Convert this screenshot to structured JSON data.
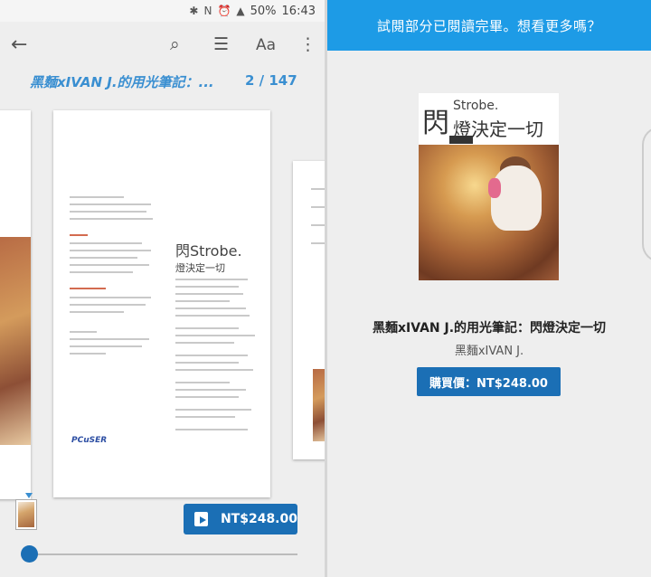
{
  "status_bar": {
    "battery": "50%",
    "time": "16:43",
    "bt_icon": "bluetooth-icon",
    "nfc_icon": "nfc-icon",
    "alarm_icon": "alarm-icon",
    "signal_icon": "signal-icon"
  },
  "reader": {
    "book_title": "黑麵xIVAN J.的用光筆記：...",
    "page_indicator": "2 / 147",
    "aa_label": "Aa",
    "buy_price": "NT$248.00",
    "progress_fraction": 0.03
  },
  "preview_end": {
    "banner": "試閱部分已閱讀完畢。想看更多嗎？",
    "book_title": "黑麵xIVAN J.的用光筆記：閃燈決定一切",
    "author": "黑麵xIVAN J.",
    "buy_label": "購買價：NT$248.00"
  },
  "cover": {
    "logo_char": "閃",
    "strobe": "Strobe.",
    "subtitle": "燈決定一切"
  },
  "page_center": {
    "logo_big": "閃Strobe.",
    "logo_small": "燈決定一切",
    "publisher": "PCuSER"
  },
  "colors": {
    "accent": "#1b6fb5",
    "banner": "#1d9be6",
    "link": "#3a8fd1"
  }
}
